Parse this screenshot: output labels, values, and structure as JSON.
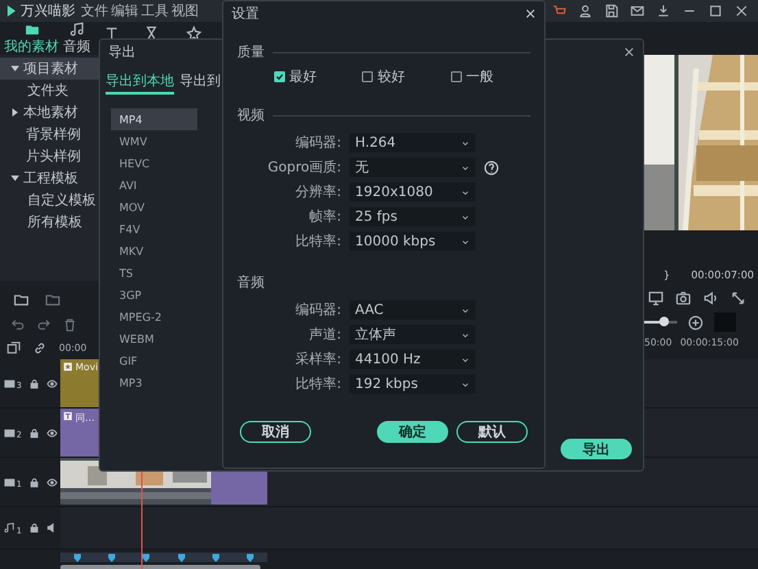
{
  "app": {
    "title": "万兴喵影",
    "menu": [
      "文件",
      "编辑",
      "工具",
      "视图"
    ]
  },
  "media_tabs": [
    {
      "label": "我的素材",
      "selected": true
    },
    {
      "label": "音频",
      "selected": false
    }
  ],
  "media_tree": [
    {
      "label": "项目素材",
      "kind": "group",
      "expanded": true,
      "selected": true,
      "children": [
        {
          "label": "文件夹",
          "selected": false
        }
      ]
    },
    {
      "label": "本地素材",
      "kind": "group",
      "expanded": false,
      "selected": false
    },
    {
      "label": "背景样例",
      "kind": "item",
      "selected": false
    },
    {
      "label": "片头样例",
      "kind": "item",
      "selected": false
    },
    {
      "label": "工程模板",
      "kind": "group",
      "expanded": true,
      "selected": false,
      "children": [
        {
          "label": "自定义模板",
          "selected": false
        },
        {
          "label": "所有模板",
          "selected": false
        }
      ]
    }
  ],
  "preview": {
    "mark_out": "}",
    "timecode": "00:00:07:00",
    "zoom": {
      "level": 0.6
    }
  },
  "timeline": {
    "ruler_start": "00:00",
    "ruler_right": [
      "50:00",
      "00:00:15:00"
    ],
    "tracks": [
      {
        "kind": "video",
        "number": "3",
        "clips": [
          {
            "kind": "title",
            "label": "Movi"
          }
        ]
      },
      {
        "kind": "video",
        "number": "2",
        "clips": [
          {
            "kind": "text",
            "label": "同…"
          }
        ]
      },
      {
        "kind": "video",
        "number": "1",
        "clips": [
          {
            "kind": "footage"
          },
          {
            "kind": "color"
          }
        ]
      },
      {
        "kind": "audio",
        "number": "1"
      }
    ]
  },
  "export_dialog": {
    "title": "导出",
    "tabs": [
      {
        "label": "导出到本地",
        "selected": true
      },
      {
        "label": "导出到",
        "selected": false
      }
    ],
    "formats": [
      {
        "label": "MP4",
        "selected": true
      },
      {
        "label": "WMV",
        "selected": false
      },
      {
        "label": "HEVC",
        "selected": false
      },
      {
        "label": "AVI",
        "selected": false
      },
      {
        "label": "MOV",
        "selected": false
      },
      {
        "label": "F4V",
        "selected": false
      },
      {
        "label": "MKV",
        "selected": false
      },
      {
        "label": "TS",
        "selected": false
      },
      {
        "label": "3GP",
        "selected": false
      },
      {
        "label": "MPEG-2",
        "selected": false
      },
      {
        "label": "WEBM",
        "selected": false
      },
      {
        "label": "GIF",
        "selected": false
      },
      {
        "label": "MP3",
        "selected": false
      }
    ],
    "export_button": "导出"
  },
  "settings_dialog": {
    "title": "设置",
    "quality": {
      "title": "质量",
      "options": [
        {
          "label": "最好",
          "checked": true
        },
        {
          "label": "较好",
          "checked": false
        },
        {
          "label": "一般",
          "checked": false
        }
      ]
    },
    "video": {
      "title": "视频",
      "fields": [
        {
          "label": "编码器:",
          "value": "H.264",
          "help": false
        },
        {
          "label": "Gopro画质:",
          "value": "无",
          "help": true
        },
        {
          "label": "分辨率:",
          "value": "1920x1080",
          "help": false
        },
        {
          "label": "帧率:",
          "value": "25 fps",
          "help": false
        },
        {
          "label": "比特率:",
          "value": "10000 kbps",
          "help": false
        }
      ]
    },
    "audio": {
      "title": "音频",
      "fields": [
        {
          "label": "编码器:",
          "value": "AAC",
          "help": false
        },
        {
          "label": "声道:",
          "value": "立体声",
          "help": false
        },
        {
          "label": "采样率:",
          "value": "44100 Hz",
          "help": false
        },
        {
          "label": "比特率:",
          "value": "192 kbps",
          "help": false
        }
      ]
    },
    "buttons": [
      {
        "label": "取消",
        "kind": "secondary"
      },
      {
        "label": "确定",
        "kind": "primary"
      },
      {
        "label": "默认",
        "kind": "secondary"
      }
    ]
  }
}
